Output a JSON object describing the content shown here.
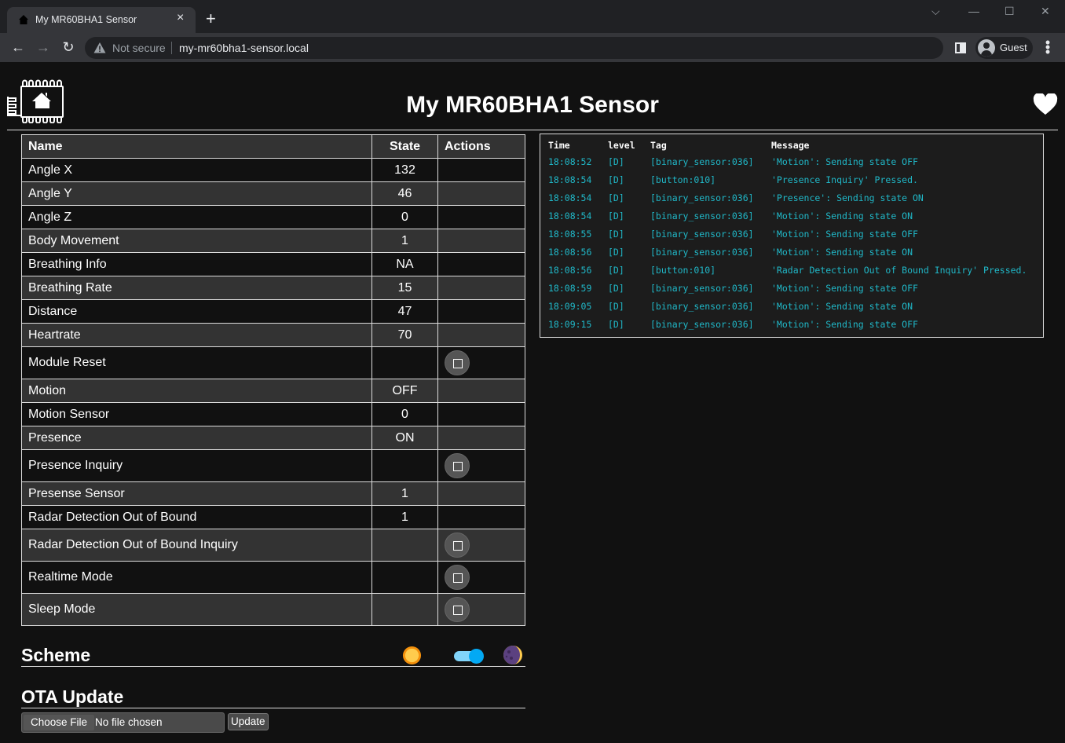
{
  "browser": {
    "tab_title": "My MR60BHA1 Sensor",
    "tab_close": "×",
    "new_tab": "+",
    "not_secure": "Not secure",
    "url": "my-mr60bha1-sensor.local",
    "profile": "Guest",
    "back": "←",
    "forward": "→",
    "reload": "↻",
    "win_dropdown": "⌵",
    "win_minimize": "—",
    "win_maximize": "☐",
    "win_close": "✕",
    "menu": "⋮"
  },
  "header": {
    "title": "My MR60BHA1 Sensor"
  },
  "entities": {
    "columns": [
      "Name",
      "State",
      "Actions"
    ],
    "rows": [
      {
        "name": "Angle X",
        "state": "132",
        "action": false
      },
      {
        "name": "Angle Y",
        "state": "46",
        "action": false
      },
      {
        "name": "Angle Z",
        "state": "0",
        "action": false
      },
      {
        "name": "Body Movement",
        "state": "1",
        "action": false
      },
      {
        "name": "Breathing Info",
        "state": "NA",
        "action": false
      },
      {
        "name": "Breathing Rate",
        "state": "15",
        "action": false
      },
      {
        "name": "Distance",
        "state": "47",
        "action": false
      },
      {
        "name": "Heartrate",
        "state": "70",
        "action": false
      },
      {
        "name": "Module Reset",
        "state": "",
        "action": true
      },
      {
        "name": "Motion",
        "state": "OFF",
        "action": false
      },
      {
        "name": "Motion Sensor",
        "state": "0",
        "action": false
      },
      {
        "name": "Presence",
        "state": "ON",
        "action": false
      },
      {
        "name": "Presence Inquiry",
        "state": "",
        "action": true
      },
      {
        "name": "Presense Sensor",
        "state": "1",
        "action": false
      },
      {
        "name": "Radar Detection Out of Bound",
        "state": "1",
        "action": false
      },
      {
        "name": "Radar Detection Out of Bound Inquiry",
        "state": "",
        "action": true
      },
      {
        "name": "Realtime Mode",
        "state": "",
        "action": true
      },
      {
        "name": "Sleep Mode",
        "state": "",
        "action": true
      }
    ]
  },
  "log": {
    "columns": [
      "Time",
      "level",
      "Tag",
      "Message"
    ],
    "color": "#20b8c8",
    "entries": [
      {
        "time": "18:08:52",
        "level": "[D]",
        "tag": "[binary_sensor:036]",
        "message": "'Motion': Sending state OFF"
      },
      {
        "time": "18:08:54",
        "level": "[D]",
        "tag": "[button:010]",
        "message": "'Presence Inquiry' Pressed."
      },
      {
        "time": "18:08:54",
        "level": "[D]",
        "tag": "[binary_sensor:036]",
        "message": "'Presence': Sending state ON"
      },
      {
        "time": "18:08:54",
        "level": "[D]",
        "tag": "[binary_sensor:036]",
        "message": "'Motion': Sending state ON"
      },
      {
        "time": "18:08:55",
        "level": "[D]",
        "tag": "[binary_sensor:036]",
        "message": "'Motion': Sending state OFF"
      },
      {
        "time": "18:08:56",
        "level": "[D]",
        "tag": "[binary_sensor:036]",
        "message": "'Motion': Sending state ON"
      },
      {
        "time": "18:08:56",
        "level": "[D]",
        "tag": "[button:010]",
        "message": "'Radar Detection Out of Bound Inquiry' Pressed."
      },
      {
        "time": "18:08:59",
        "level": "[D]",
        "tag": "[binary_sensor:036]",
        "message": "'Motion': Sending state OFF"
      },
      {
        "time": "18:09:05",
        "level": "[D]",
        "tag": "[binary_sensor:036]",
        "message": "'Motion': Sending state ON"
      },
      {
        "time": "18:09:15",
        "level": "[D]",
        "tag": "[binary_sensor:036]",
        "message": "'Motion': Sending state OFF"
      }
    ]
  },
  "scheme": {
    "title": "Scheme",
    "dark_mode": true,
    "icons": [
      "sun-icon",
      "moon-icon"
    ]
  },
  "ota": {
    "title": "OTA Update",
    "choose_file": "Choose File",
    "no_file": "No file chosen",
    "update": "Update"
  }
}
